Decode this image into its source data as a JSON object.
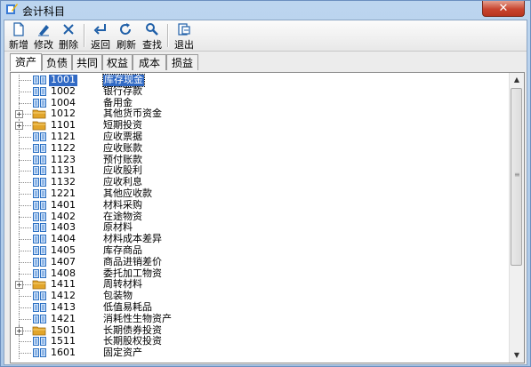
{
  "window": {
    "title": "会计科目",
    "close_glyph": "✕"
  },
  "toolbar": {
    "buttons": [
      {
        "id": "new",
        "label": "新增",
        "icon": "new-doc-icon"
      },
      {
        "id": "edit",
        "label": "修改",
        "icon": "pencil-icon"
      },
      {
        "id": "delete",
        "label": "删除",
        "icon": "delete-x-icon"
      },
      {
        "id": "back",
        "label": "返回",
        "icon": "return-arrow-icon"
      },
      {
        "id": "refresh",
        "label": "刷新",
        "icon": "refresh-icon"
      },
      {
        "id": "find",
        "label": "查找",
        "icon": "magnifier-icon"
      },
      {
        "id": "exit",
        "label": "退出",
        "icon": "exit-icon"
      }
    ]
  },
  "tabs": [
    {
      "label": "资产",
      "active": true
    },
    {
      "label": "负债",
      "active": false
    },
    {
      "label": "共同",
      "active": false
    },
    {
      "label": "权益",
      "active": false
    },
    {
      "label": "成本",
      "active": false
    },
    {
      "label": "损益",
      "active": false
    }
  ],
  "tree": {
    "rows": [
      {
        "code": "1001",
        "name": "库存现金",
        "expandable": false,
        "selected": true
      },
      {
        "code": "1002",
        "name": "银行存款",
        "expandable": false
      },
      {
        "code": "1004",
        "name": "备用金",
        "expandable": false
      },
      {
        "code": "1012",
        "name": "其他货币资金",
        "expandable": true
      },
      {
        "code": "1101",
        "name": "短期投资",
        "expandable": true
      },
      {
        "code": "1121",
        "name": "应收票据",
        "expandable": false
      },
      {
        "code": "1122",
        "name": "应收账款",
        "expandable": false
      },
      {
        "code": "1123",
        "name": "预付账款",
        "expandable": false
      },
      {
        "code": "1131",
        "name": "应收股利",
        "expandable": false
      },
      {
        "code": "1132",
        "name": "应收利息",
        "expandable": false
      },
      {
        "code": "1221",
        "name": "其他应收款",
        "expandable": false
      },
      {
        "code": "1401",
        "name": "材料采购",
        "expandable": false
      },
      {
        "code": "1402",
        "name": "在途物资",
        "expandable": false
      },
      {
        "code": "1403",
        "name": "原材料",
        "expandable": false
      },
      {
        "code": "1404",
        "name": "材料成本差异",
        "expandable": false
      },
      {
        "code": "1405",
        "name": "库存商品",
        "expandable": false
      },
      {
        "code": "1407",
        "name": "商品进销差价",
        "expandable": false
      },
      {
        "code": "1408",
        "name": "委托加工物资",
        "expandable": false
      },
      {
        "code": "1411",
        "name": "周转材料",
        "expandable": true
      },
      {
        "code": "1412",
        "name": "包装物",
        "expandable": false
      },
      {
        "code": "1413",
        "name": "低值易耗品",
        "expandable": false
      },
      {
        "code": "1421",
        "name": "消耗性生物资产",
        "expandable": false
      },
      {
        "code": "1501",
        "name": "长期债券投资",
        "expandable": true
      },
      {
        "code": "1511",
        "name": "长期股权投资",
        "expandable": false
      },
      {
        "code": "1601",
        "name": "固定资产",
        "expandable": false
      }
    ]
  },
  "colors": {
    "selection": "#316ac5",
    "folder": "#e2a52a",
    "book": "#2b6fc1"
  }
}
